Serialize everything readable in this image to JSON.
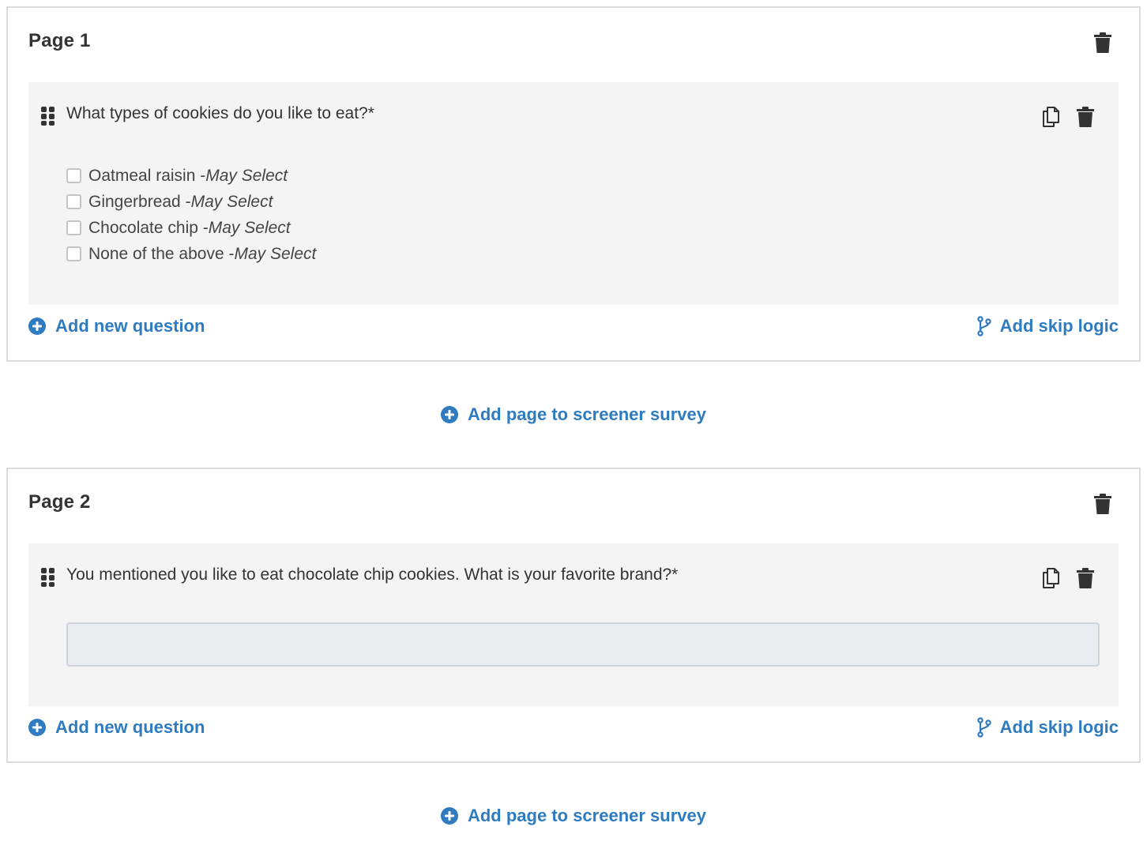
{
  "pages": [
    {
      "title": "Page 1",
      "question": {
        "text": "What types of cookies do you like to eat?*",
        "options": [
          {
            "label": "Oatmeal raisin - ",
            "hint": "May Select"
          },
          {
            "label": "Gingerbread - ",
            "hint": "May Select"
          },
          {
            "label": "Chocolate chip - ",
            "hint": "May Select"
          },
          {
            "label": "None of the above - ",
            "hint": "May Select"
          }
        ]
      },
      "add_question_label": "Add new question",
      "skip_logic_label": "Add skip logic"
    },
    {
      "title": "Page 2",
      "question": {
        "text": "You mentioned you like to eat chocolate chip cookies. What is your favorite brand?*",
        "answer_value": ""
      },
      "add_question_label": "Add new question",
      "skip_logic_label": "Add skip logic"
    }
  ],
  "add_page_label": "Add page to screener survey",
  "colors": {
    "link": "#2f7bbf",
    "icon": "#333333",
    "question_bg": "#f4f4f4",
    "border": "#dcdcdc",
    "input_bg": "#e9ecef"
  }
}
